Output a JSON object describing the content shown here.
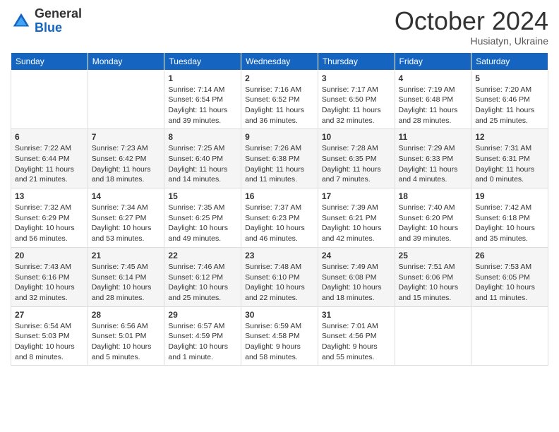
{
  "header": {
    "logo_general": "General",
    "logo_blue": "Blue",
    "month_title": "October 2024",
    "location": "Husiatyn, Ukraine"
  },
  "days_of_week": [
    "Sunday",
    "Monday",
    "Tuesday",
    "Wednesday",
    "Thursday",
    "Friday",
    "Saturday"
  ],
  "weeks": [
    [
      {
        "day": "",
        "info": ""
      },
      {
        "day": "",
        "info": ""
      },
      {
        "day": "1",
        "info": "Sunrise: 7:14 AM\nSunset: 6:54 PM\nDaylight: 11 hours and 39 minutes."
      },
      {
        "day": "2",
        "info": "Sunrise: 7:16 AM\nSunset: 6:52 PM\nDaylight: 11 hours and 36 minutes."
      },
      {
        "day": "3",
        "info": "Sunrise: 7:17 AM\nSunset: 6:50 PM\nDaylight: 11 hours and 32 minutes."
      },
      {
        "day": "4",
        "info": "Sunrise: 7:19 AM\nSunset: 6:48 PM\nDaylight: 11 hours and 28 minutes."
      },
      {
        "day": "5",
        "info": "Sunrise: 7:20 AM\nSunset: 6:46 PM\nDaylight: 11 hours and 25 minutes."
      }
    ],
    [
      {
        "day": "6",
        "info": "Sunrise: 7:22 AM\nSunset: 6:44 PM\nDaylight: 11 hours and 21 minutes."
      },
      {
        "day": "7",
        "info": "Sunrise: 7:23 AM\nSunset: 6:42 PM\nDaylight: 11 hours and 18 minutes."
      },
      {
        "day": "8",
        "info": "Sunrise: 7:25 AM\nSunset: 6:40 PM\nDaylight: 11 hours and 14 minutes."
      },
      {
        "day": "9",
        "info": "Sunrise: 7:26 AM\nSunset: 6:38 PM\nDaylight: 11 hours and 11 minutes."
      },
      {
        "day": "10",
        "info": "Sunrise: 7:28 AM\nSunset: 6:35 PM\nDaylight: 11 hours and 7 minutes."
      },
      {
        "day": "11",
        "info": "Sunrise: 7:29 AM\nSunset: 6:33 PM\nDaylight: 11 hours and 4 minutes."
      },
      {
        "day": "12",
        "info": "Sunrise: 7:31 AM\nSunset: 6:31 PM\nDaylight: 11 hours and 0 minutes."
      }
    ],
    [
      {
        "day": "13",
        "info": "Sunrise: 7:32 AM\nSunset: 6:29 PM\nDaylight: 10 hours and 56 minutes."
      },
      {
        "day": "14",
        "info": "Sunrise: 7:34 AM\nSunset: 6:27 PM\nDaylight: 10 hours and 53 minutes."
      },
      {
        "day": "15",
        "info": "Sunrise: 7:35 AM\nSunset: 6:25 PM\nDaylight: 10 hours and 49 minutes."
      },
      {
        "day": "16",
        "info": "Sunrise: 7:37 AM\nSunset: 6:23 PM\nDaylight: 10 hours and 46 minutes."
      },
      {
        "day": "17",
        "info": "Sunrise: 7:39 AM\nSunset: 6:21 PM\nDaylight: 10 hours and 42 minutes."
      },
      {
        "day": "18",
        "info": "Sunrise: 7:40 AM\nSunset: 6:20 PM\nDaylight: 10 hours and 39 minutes."
      },
      {
        "day": "19",
        "info": "Sunrise: 7:42 AM\nSunset: 6:18 PM\nDaylight: 10 hours and 35 minutes."
      }
    ],
    [
      {
        "day": "20",
        "info": "Sunrise: 7:43 AM\nSunset: 6:16 PM\nDaylight: 10 hours and 32 minutes."
      },
      {
        "day": "21",
        "info": "Sunrise: 7:45 AM\nSunset: 6:14 PM\nDaylight: 10 hours and 28 minutes."
      },
      {
        "day": "22",
        "info": "Sunrise: 7:46 AM\nSunset: 6:12 PM\nDaylight: 10 hours and 25 minutes."
      },
      {
        "day": "23",
        "info": "Sunrise: 7:48 AM\nSunset: 6:10 PM\nDaylight: 10 hours and 22 minutes."
      },
      {
        "day": "24",
        "info": "Sunrise: 7:49 AM\nSunset: 6:08 PM\nDaylight: 10 hours and 18 minutes."
      },
      {
        "day": "25",
        "info": "Sunrise: 7:51 AM\nSunset: 6:06 PM\nDaylight: 10 hours and 15 minutes."
      },
      {
        "day": "26",
        "info": "Sunrise: 7:53 AM\nSunset: 6:05 PM\nDaylight: 10 hours and 11 minutes."
      }
    ],
    [
      {
        "day": "27",
        "info": "Sunrise: 6:54 AM\nSunset: 5:03 PM\nDaylight: 10 hours and 8 minutes."
      },
      {
        "day": "28",
        "info": "Sunrise: 6:56 AM\nSunset: 5:01 PM\nDaylight: 10 hours and 5 minutes."
      },
      {
        "day": "29",
        "info": "Sunrise: 6:57 AM\nSunset: 4:59 PM\nDaylight: 10 hours and 1 minute."
      },
      {
        "day": "30",
        "info": "Sunrise: 6:59 AM\nSunset: 4:58 PM\nDaylight: 9 hours and 58 minutes."
      },
      {
        "day": "31",
        "info": "Sunrise: 7:01 AM\nSunset: 4:56 PM\nDaylight: 9 hours and 55 minutes."
      },
      {
        "day": "",
        "info": ""
      },
      {
        "day": "",
        "info": ""
      }
    ]
  ]
}
